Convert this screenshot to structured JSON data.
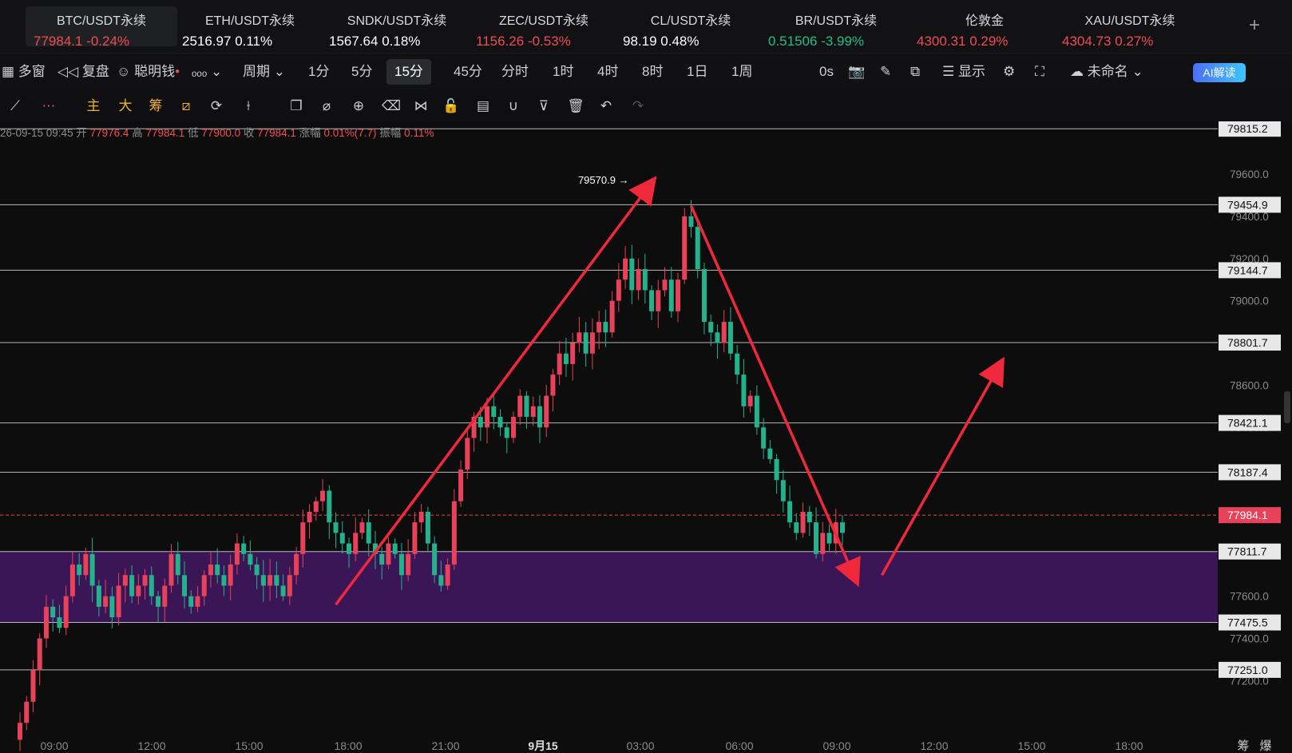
{
  "tickers": [
    {
      "name": "BTC/USDT永续",
      "price": "77984.1",
      "change": "-0.24%",
      "tone": "up",
      "active": true
    },
    {
      "name": "ETH/USDT永续",
      "price": "2516.97",
      "change": "0.11%",
      "tone": "wh"
    },
    {
      "name": "SNDK/USDT永续",
      "price": "1567.64",
      "change": "0.18%",
      "tone": "wh"
    },
    {
      "name": "ZEC/USDT永续",
      "price": "1156.26",
      "change": "-0.53%",
      "tone": "up"
    },
    {
      "name": "CL/USDT永续",
      "price": "98.19",
      "change": "0.48%",
      "tone": "wh"
    },
    {
      "name": "BR/USDT永续",
      "price": "0.51506",
      "change": "-3.99%",
      "tone": "dn"
    },
    {
      "name": "伦敦金",
      "price": "4300.31",
      "change": "0.29%",
      "tone": "up"
    },
    {
      "name": "XAU/USDT永续",
      "price": "4304.73",
      "change": "0.27%",
      "tone": "up"
    }
  ],
  "toolbar": {
    "multi_window": "多窗",
    "replay": "复盘",
    "smart_money": "聪明钱",
    "period": "周期",
    "intervals": [
      "1分",
      "5分",
      "15分",
      "45分",
      "分时",
      "1时",
      "4时",
      "8时",
      "1日",
      "1周"
    ],
    "selected_interval": "15分",
    "countdown": "0s",
    "display": "显示",
    "layout_name": "未命名",
    "ai_label": "AI解读"
  },
  "drawing_tools": {
    "main": "主",
    "big": "大",
    "chip": "筹"
  },
  "candle_info": {
    "date": "26-09-15 09:45",
    "open_label": "开",
    "open": "77976.4",
    "high_label": "高",
    "high": "77984.1",
    "low_label": "低",
    "low": "77900.0",
    "close_label": "收",
    "close": "77984.1",
    "change_label": "涨幅",
    "change": "0.01%(7.7)",
    "amp_label": "振幅",
    "amp": "0.11%"
  },
  "chart_data": {
    "type": "candlestick",
    "symbol": "BTC/USDT永续",
    "interval": "15分",
    "y_ticks": [
      79600.0,
      79400.0,
      79200.0,
      79000.0,
      78800.0,
      78600.0,
      78400.0,
      78200.0,
      78000.0,
      77800.0,
      77600.0,
      77400.0,
      77200.0
    ],
    "ylim": [
      77050,
      79850
    ],
    "x_ticks": [
      "09:00",
      "12:00",
      "15:00",
      "18:00",
      "21:00",
      "9月15",
      "03:00",
      "06:00",
      "09:00",
      "12:00",
      "15:00",
      "18:00"
    ],
    "horizontal_levels": [
      79815.2,
      79454.9,
      79144.7,
      78801.7,
      78421.1,
      78187.4,
      77811.7,
      77475.5,
      77251.0
    ],
    "current_price": 77984.1,
    "high_marker": "79570.9",
    "zone": [
      77475.5,
      77811.7
    ],
    "corner_labels": [
      "筹",
      "爆"
    ],
    "colors": {
      "up": "#e8415a",
      "down": "#23b28c",
      "zone": "#3a1657",
      "arrow": "#f0283c"
    },
    "closes": [
      77000,
      77100,
      77250,
      77400,
      77550,
      77500,
      77450,
      77600,
      77750,
      77700,
      77800,
      77650,
      77550,
      77600,
      77500,
      77650,
      77700,
      77600,
      77650,
      77700,
      77600,
      77550,
      77650,
      77800,
      77700,
      77600,
      77550,
      77600,
      77700,
      77750,
      77700,
      77650,
      77750,
      77850,
      77800,
      77750,
      77700,
      77650,
      77700,
      77650,
      77600,
      77700,
      77800,
      77950,
      78000,
      78050,
      78100,
      77950,
      77900,
      77850,
      77800,
      77900,
      77950,
      77850,
      77800,
      77750,
      77850,
      77800,
      77700,
      77800,
      77950,
      78000,
      77850,
      77700,
      77650,
      77750,
      78050,
      78200,
      78350,
      78450,
      78400,
      78500,
      78450,
      78400,
      78350,
      78450,
      78550,
      78450,
      78500,
      78400,
      78550,
      78650,
      78750,
      78700,
      78800,
      78850,
      78750,
      78850,
      78900,
      78850,
      79000,
      79100,
      79200,
      79050,
      79150,
      79050,
      78950,
      79050,
      79100,
      78950,
      79100,
      79400,
      79350,
      79150,
      78900,
      78850,
      78800,
      78900,
      78750,
      78650,
      78500,
      78550,
      78400,
      78300,
      78250,
      78150,
      78050,
      77950,
      77900,
      78000,
      77950,
      77800,
      77900,
      77850,
      77950,
      77900
    ]
  }
}
